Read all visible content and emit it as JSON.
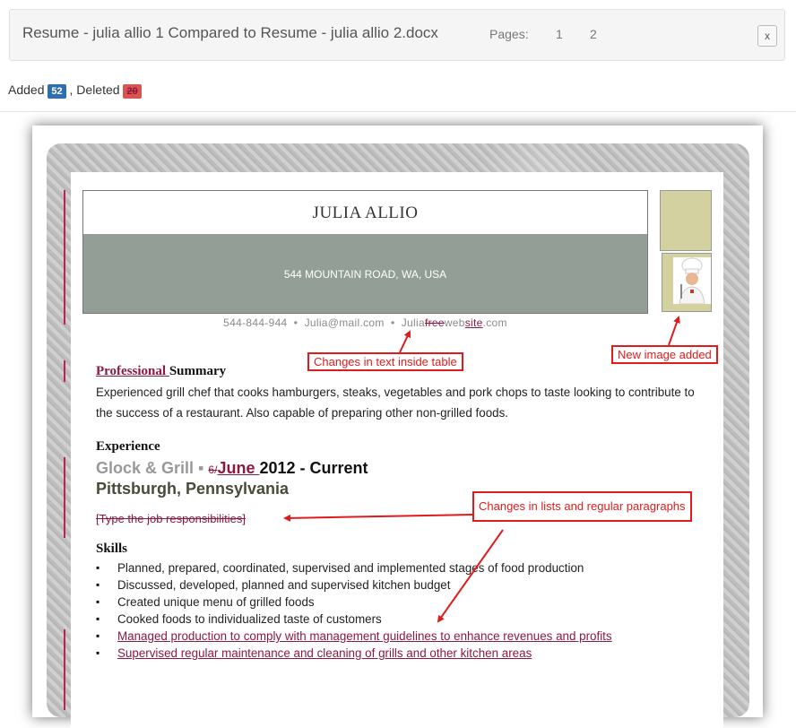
{
  "header": {
    "title": "Resume - julia allio 1 Compared to Resume - julia allio 2.docx",
    "pages_label": "Pages:",
    "pages": [
      "1",
      "2"
    ],
    "close_label": "x"
  },
  "stats": {
    "added_label": "Added",
    "added_count": "52",
    "separator": ", Deleted",
    "deleted_count": "20"
  },
  "resume": {
    "name": "JULIA ALLIO",
    "address": "544 MOUNTAIN ROAD,  WA, USA",
    "contact": {
      "phone": "544-844-944",
      "bullet": "•",
      "email": "Julia@mail.com",
      "website_prefix": "Julia",
      "website_deleted": "free",
      "website_middle": "web",
      "website_inserted": "site",
      "website_suffix": ".com"
    },
    "summary": {
      "title_inserted": "Professional ",
      "title": "Summary",
      "text": "Experienced grill chef that cooks hamburgers, steaks, vegetables and pork chops to taste looking to contribute to the success of a restaurant. Also  capable of preparing other non-grilled foods."
    },
    "experience": {
      "title": "Experience",
      "company": "Glock & Grill",
      "company_sep": " ▪ ",
      "date_deleted": "6/",
      "date_inserted": "June ",
      "date_rest": "2012 - Current",
      "location": "Pittsburgh, Pennsylvania",
      "deleted_line": "[Type the job responsibilities]"
    },
    "skills": {
      "title": "Skills",
      "items": [
        {
          "text": "Planned, prepared, coordinated, supervised and implemented stages of food production",
          "inserted": false
        },
        {
          "text": "Discussed,  developed, planned and supervised kitchen budget",
          "inserted": false
        },
        {
          "text": "Created unique menu of grilled foods",
          "inserted": false
        },
        {
          "text": "Cooked foods to individualized taste of customers",
          "inserted": false
        },
        {
          "text": "Managed production to comply with management guidelines to enhance revenues and profits",
          "inserted": true
        },
        {
          "text": "Supervised regular maintenance and cleaning of grills and other kitchen areas",
          "inserted": true
        }
      ]
    }
  },
  "annotations": {
    "table_text": "Changes in text inside table",
    "new_image": "New image added",
    "lists_paragraphs": "Changes in lists and regular paragraphs",
    "color": "#e01b1b"
  }
}
